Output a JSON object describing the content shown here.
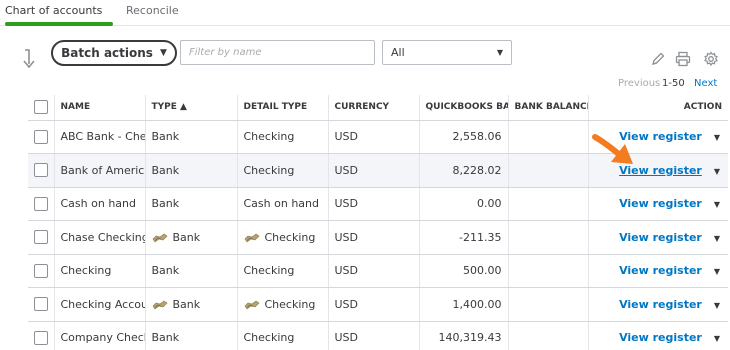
{
  "tabs": [
    {
      "label": "Chart of accounts",
      "active": true
    },
    {
      "label": "Reconcile",
      "active": false
    }
  ],
  "toolbar": {
    "batch_actions": "Batch actions",
    "filter_placeholder": "Filter by name",
    "filter_select": "All"
  },
  "pagination": {
    "previous": "Previous",
    "range": "1-50",
    "next": "Next"
  },
  "table": {
    "headers": {
      "name": "NAME",
      "type": "TYPE ▲",
      "detail_type": "DETAIL TYPE",
      "currency": "CURRENCY",
      "qb_balance": "QUICKBOOKS BALANCE",
      "bank_balance": "BANK BALANCE",
      "action": "ACTION"
    },
    "rows": [
      {
        "name": "ABC Bank - Checking",
        "type": "Bank",
        "detail": "Checking",
        "currency": "USD",
        "balance": "2,558.06",
        "bank_balance": "",
        "action": "View register"
      },
      {
        "name": "Bank of America Checking",
        "type": "Bank",
        "detail": "Checking",
        "currency": "USD",
        "balance": "8,228.02",
        "bank_balance": "",
        "action": "View register"
      },
      {
        "name": "Cash on hand",
        "type": "Bank",
        "detail": "Cash on hand",
        "currency": "USD",
        "balance": "0.00",
        "bank_balance": "",
        "action": "View register"
      },
      {
        "name": "Chase Checking Account",
        "type": "Bank",
        "detail": "Checking",
        "currency": "USD",
        "balance": "-211.35",
        "bank_balance": "",
        "action": "View register"
      },
      {
        "name": "Checking",
        "type": "Bank",
        "detail": "Checking",
        "currency": "USD",
        "balance": "500.00",
        "bank_balance": "",
        "action": "View register"
      },
      {
        "name": "Checking Account",
        "type": "Bank",
        "detail": "Checking",
        "currency": "USD",
        "balance": "1,400.00",
        "bank_balance": "",
        "action": "View register"
      },
      {
        "name": "Company Checking",
        "type": "Bank",
        "detail": "Checking",
        "currency": "USD",
        "balance": "140,319.43",
        "bank_balance": "",
        "action": "View register"
      }
    ]
  },
  "colors": {
    "accent": "#2ca01c",
    "link": "#0077c5",
    "callout": "#f37b20"
  },
  "icons": [
    "sort-arrow-icon",
    "pencil-icon",
    "printer-icon",
    "gear-icon",
    "bank-feed-icon",
    "orange-pointer-arrow"
  ]
}
